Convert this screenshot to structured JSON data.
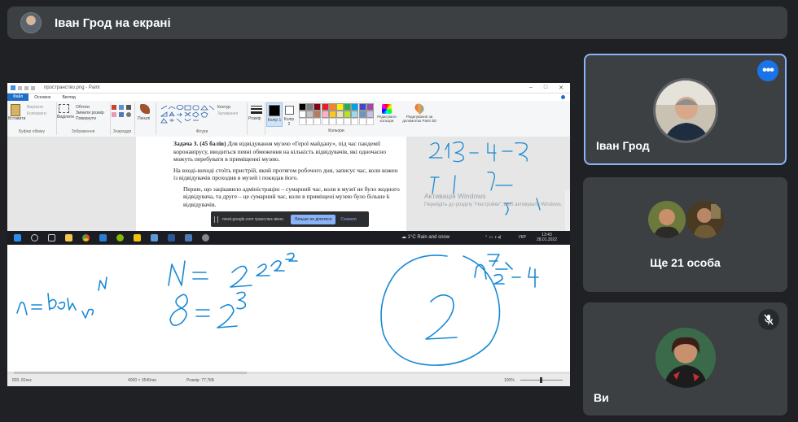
{
  "presenter_bar": {
    "title": "Іван Грод на екрані"
  },
  "paint": {
    "window_title": "пространство.png - Paint",
    "tabs": [
      "Файл",
      "Основне",
      "Вигляд"
    ],
    "ribbon": {
      "clipboard": {
        "paste": "Вставити",
        "cut": "Вирізати",
        "copy": "Копіювати",
        "caption": "Буфер обміну"
      },
      "image": {
        "select": "Виділити",
        "crop": "Обтяти",
        "resize": "Змінити розмір",
        "rotate": "Повернути",
        "caption": "Зображення"
      },
      "tools": {
        "caption": "Знаряддя"
      },
      "brushes": {
        "label": "Пензлі"
      },
      "shapes": {
        "outline": "Контур",
        "fill": "Заливання",
        "caption": "Фігури"
      },
      "size": {
        "label": "Розмір"
      },
      "color1": {
        "label": "Колір 1"
      },
      "color2": {
        "label": "Колір 2"
      },
      "colors": {
        "caption": "Кольори"
      },
      "edit_colors": {
        "label": "Редагувати кольори"
      },
      "paint3d": {
        "label": "Редагування за допомогою Paint 3D"
      }
    },
    "document": {
      "heading_bold": "Задача 3. (45 балів)",
      "heading_rest": "Для відвідування музею «Герої майдану», під час пандемії коронавірусу, вводиться певні обмеження на кількість відвідувачів, які одночасно можуть перебувати в приміщенні музею.",
      "paragraph2": "На вході-виході стоїть пристрій, який протягом робочого дня, записує час, коли кожен із відвідувачів проходив в музей і покидав його.",
      "paragraph3": "Перше, що зацікавило адміністрацію – сумарний час, коли в музеї не було жодного відвідувача, та друге – це сумарний час, коли в приміщені музею було більше k відвідувачів."
    },
    "watermark": {
      "line1": "Активація Windows",
      "line2": "Перейдіть до розділу \"Настройки\", щоб активувати Windows."
    },
    "status": {
      "coords": "820, 81пкс",
      "dimensions": "4000 × 3540пкс",
      "size": "Розмір: 77,7КБ",
      "zoom": "100%"
    }
  },
  "share_notification": {
    "text": "meet.google.com транслює вікно.",
    "stop_button": "Більше не ділитися",
    "hide_button": "Сховати"
  },
  "taskbar": {
    "weather": "1°C Rain and snow",
    "language": "УКР",
    "time": "13:43",
    "date": "28.01.2022"
  },
  "participants": [
    {
      "name": "Іван Грод",
      "tile": "active-speaker"
    },
    {
      "name": "Ще 21 особа",
      "tile": "others"
    },
    {
      "name": "Ви",
      "tile": "self",
      "muted": true
    }
  ],
  "colors": {
    "meet_bg": "#202124",
    "tile_bg": "#3c4043",
    "accent_blue": "#1a73e8",
    "active_border": "#8ab4f8",
    "ink_blue": "#1a8ad4"
  }
}
